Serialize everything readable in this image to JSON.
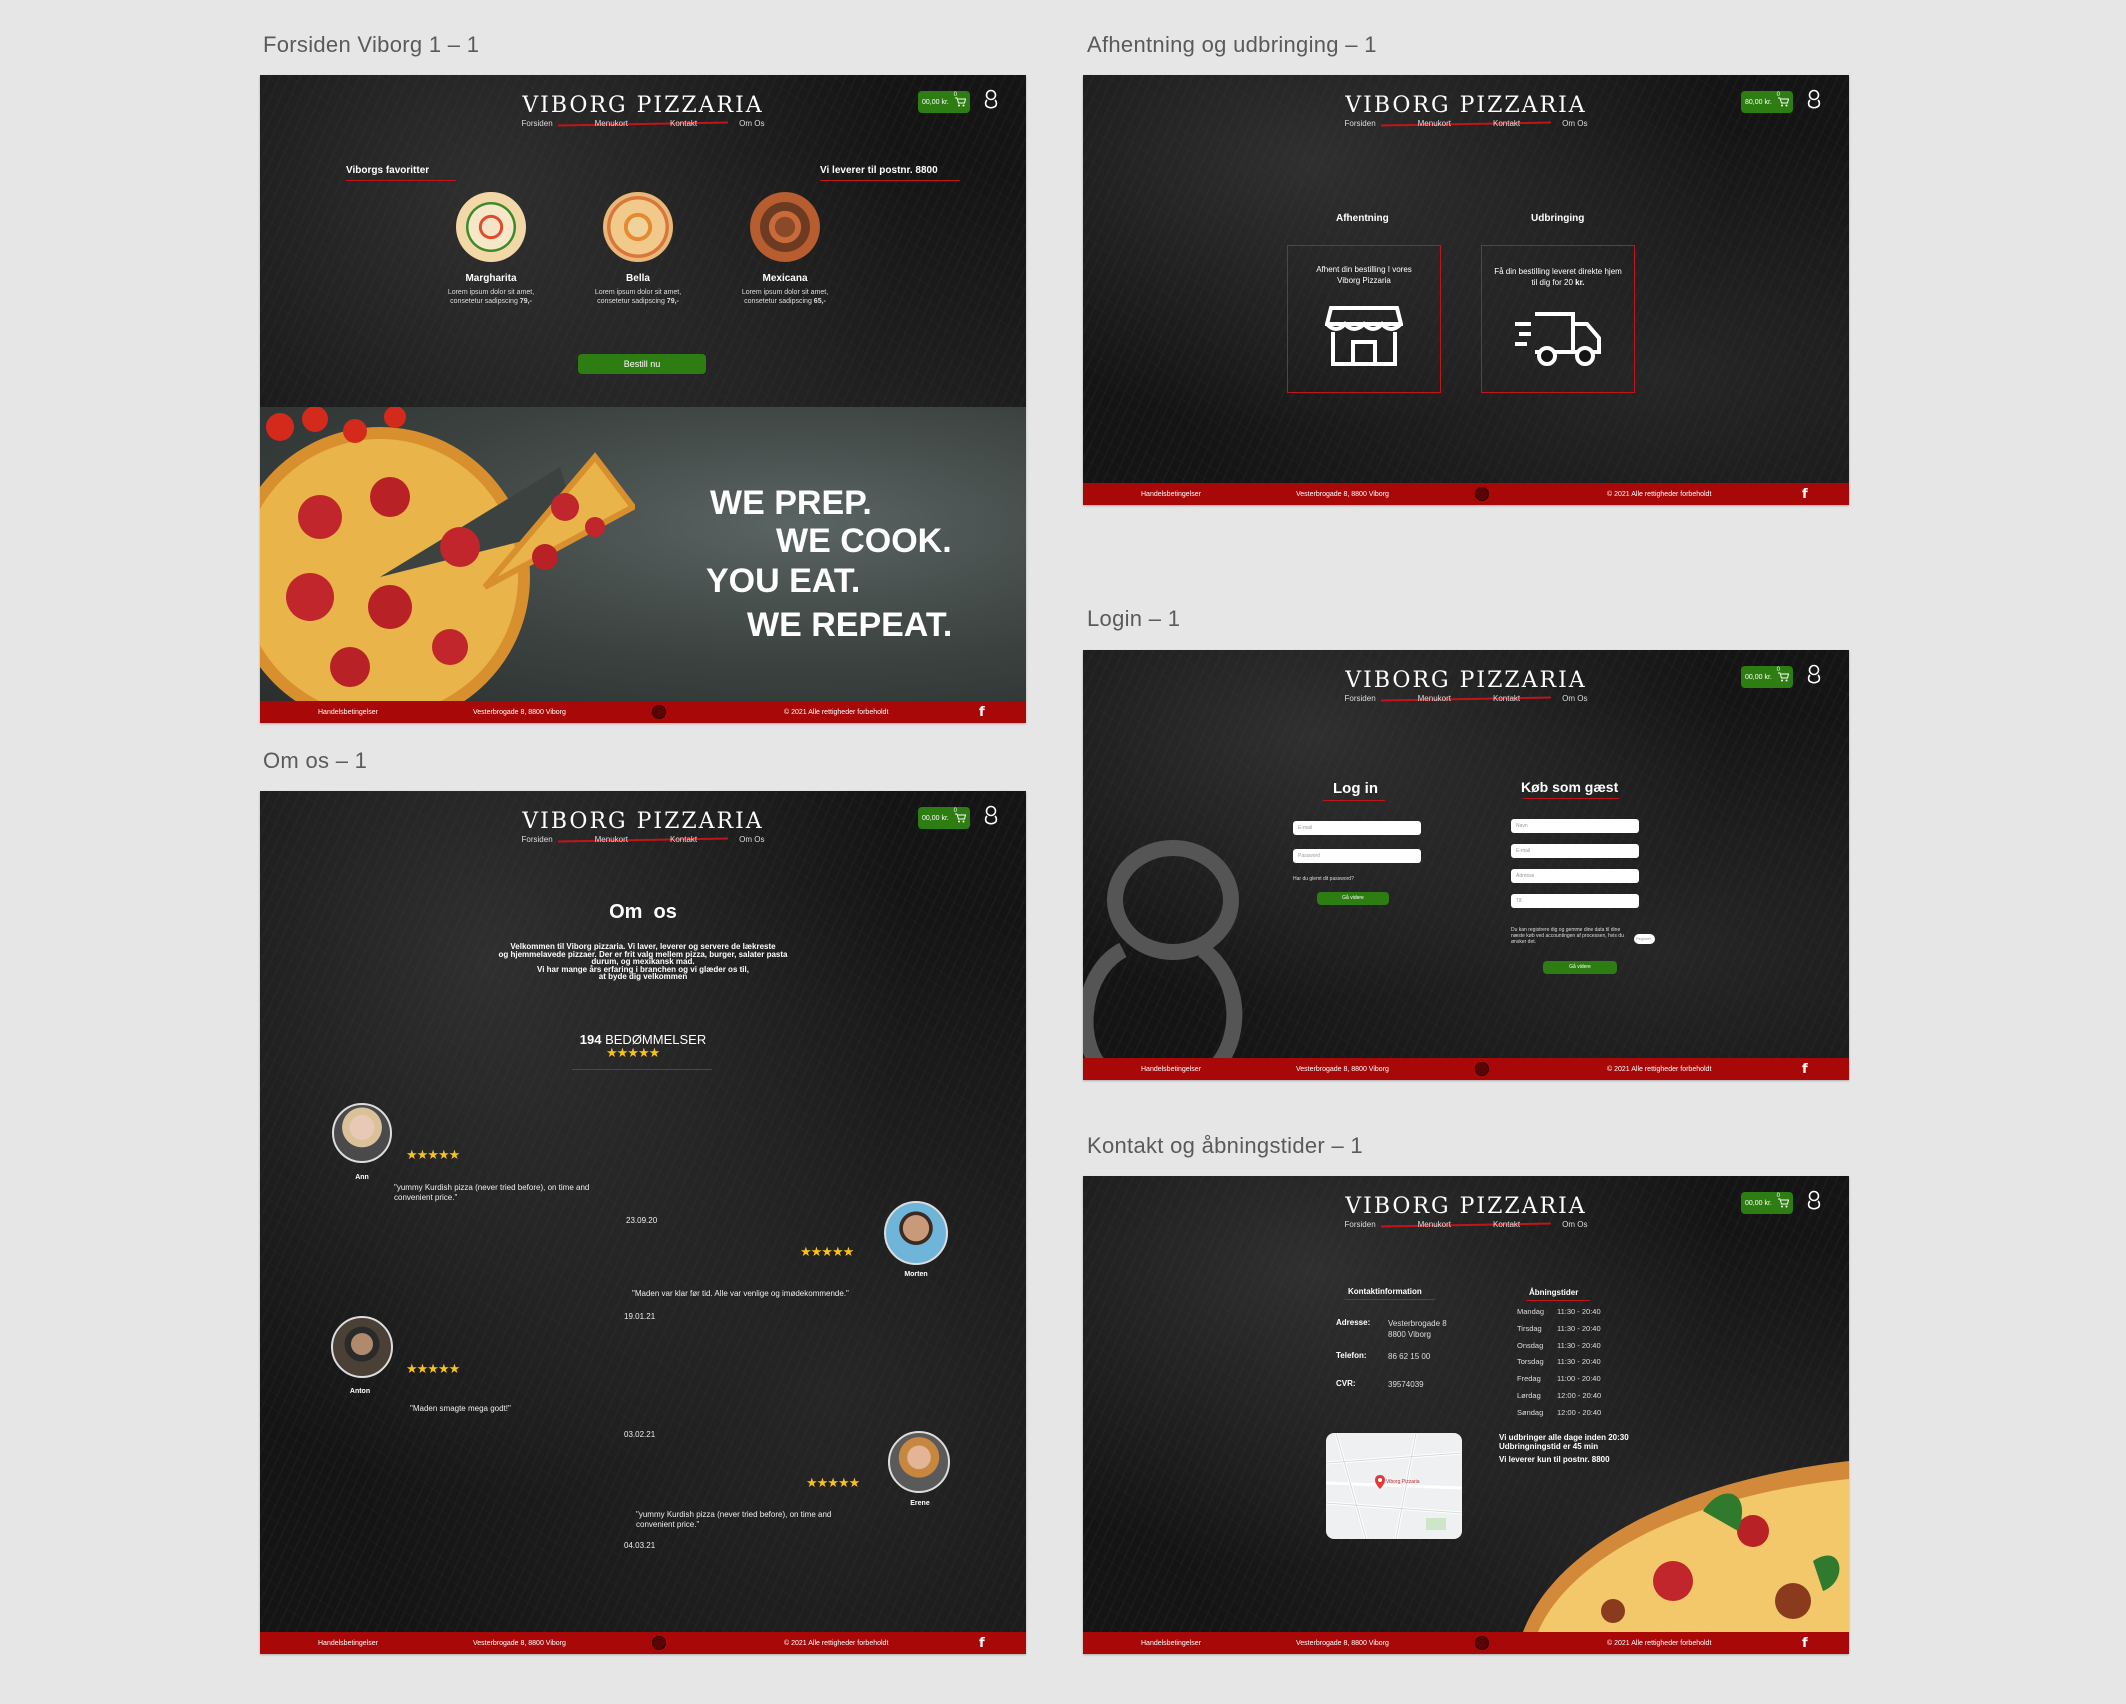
{
  "artboards": {
    "forsiden": "Forsiden Viborg  1 – 1",
    "afhentning": "Afhentning og udbringing – 1",
    "omos": "Om os – 1",
    "login": "Login – 1",
    "kontakt": "Kontakt og åbningstider – 1"
  },
  "brand": {
    "logo": "VIBORG PIZZARIA",
    "accent": "#c0161b",
    "green": "#2e7d12",
    "footer_red": "#a90808"
  },
  "header": {
    "cart_price": "00,00 kr.",
    "cart_price_alt": "80,00 kr.",
    "cart_count": "0",
    "nav": [
      "Forsiden",
      "Menukort",
      "Kontakt",
      "Om Os"
    ]
  },
  "footer": {
    "terms": "Handelsbetingelser",
    "address": "Vesterbrogade 8, 8800 Viborg",
    "copyright": "© 2021 Alle rettigheder forbeholdt",
    "facebook": "f"
  },
  "home": {
    "favorites_heading": "Viborgs favoritter",
    "delivery_heading": "Vi leverer til postnr. 8800",
    "pizzas": [
      {
        "name": "Margharita",
        "desc1": "Lorem ipsum dolor sit amet,",
        "desc2": "consetetur sadipscing",
        "price": "79,-"
      },
      {
        "name": "Bella",
        "desc1": "Lorem ipsum dolor sit amet,",
        "desc2": "consetetur sadipscing",
        "price": "79,-"
      },
      {
        "name": "Mexicana",
        "desc1": "Lorem ipsum dolor sit amet,",
        "desc2": "consetetur sadipscing",
        "price": "65,-"
      }
    ],
    "order_button": "Bestill nu",
    "slogan": [
      "WE PREP.",
      "WE COOK.",
      "YOU EAT.",
      "WE REPEAT."
    ]
  },
  "pickup": {
    "pickup_title": "Afhentning",
    "pickup_text": "Afhent din bestilling I vores Viborg Pizzaria",
    "delivery_title": "Udbringing",
    "delivery_text": "Få din bestilling leveret direkte hjem til dig for 20",
    "delivery_price": "kr."
  },
  "login": {
    "login_title": "Log in",
    "email_placeholder": "E-mail",
    "password_placeholder": "Password",
    "forgot": "Har du glemt dit password?",
    "login_button": "Gå videre",
    "guest_title": "Køb som gæst",
    "guest_fields": [
      "Navn",
      "E-mail",
      "Adresse",
      "Tlf."
    ],
    "guest_note": "Du kan registrere dig og gemme dine data til dine næste køb ved accountingen af processen, hvis du ønsker det.",
    "register_button": "Register",
    "guest_button": "Gå videre"
  },
  "about": {
    "title": "Om  os",
    "intro": [
      "Velkommen til Viborg pizzaria. Vi laver, leverer og servere de lækreste",
      "og hjemmelavede pizzaer.  Der er frit valg mellem pizza, burger, salater pasta",
      "durum, og mexikansk mad.",
      "Vi har mange års erfaring i branchen og vi glæder os til,",
      "at byde dig velkommen"
    ],
    "ratings_count": "194",
    "ratings_label": "BEDØMMELSER",
    "stars": "★★★★★",
    "reviews": [
      {
        "name": "Ann",
        "text1": "\"yummy Kurdish pizza (never tried before), on time and",
        "text2": "convenient price.\"",
        "date": "23.09.20"
      },
      {
        "name": "Morten",
        "text1": "\"Maden var klar før tid. Alle var venlige og imødekommende.\"",
        "text2": "",
        "date": "19.01.21"
      },
      {
        "name": "Anton",
        "text1": "\"Maden smagte mega godt!\"",
        "text2": "",
        "date": "03.02.21"
      },
      {
        "name": "Erene",
        "text1": "\"yummy Kurdish pizza (never tried before), on time and",
        "text2": "convenient price.\"",
        "date": "04.03.21"
      }
    ]
  },
  "contact": {
    "info_title": "Kontaktinformation",
    "address_label": "Adresse:",
    "address1": "Vesterbrogade 8",
    "address2": "8800 Viborg",
    "phone_label": "Telefon:",
    "phone": "86 62 15 00",
    "cvr_label": "CVR:",
    "cvr": "39574039",
    "hours_title": "Åbningstider",
    "hours": [
      {
        "day": "Mandag",
        "time": "11:30 - 20:40"
      },
      {
        "day": "Tirsdag",
        "time": "11:30 - 20:40"
      },
      {
        "day": "Onsdag",
        "time": "11:30 - 20:40"
      },
      {
        "day": "Torsdag",
        "time": "11:30 - 20:40"
      },
      {
        "day": "Fredag",
        "time": "11:00 - 20:40"
      },
      {
        "day": "Lørdag",
        "time": "12:00 - 20:40"
      },
      {
        "day": "Søndag",
        "time": "12:00 - 20:40"
      }
    ],
    "delivery_note1": "Vi udbringer alle dage inden 20:30",
    "delivery_note2": "Udbringningstid er 45 min",
    "delivery_note3": "Vi leverer kun til postnr. 8800",
    "map_pin": "Viborg Pizzaria"
  }
}
